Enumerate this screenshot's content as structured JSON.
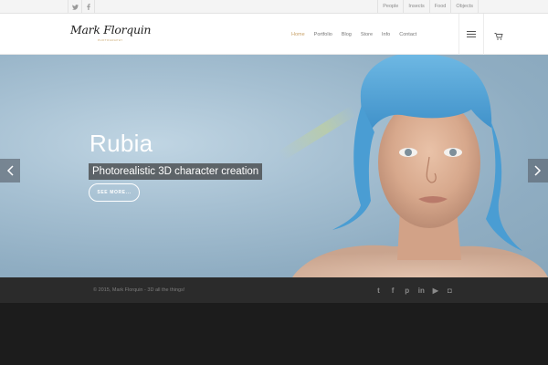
{
  "topbar": {
    "social_icons": [
      "twitter-icon",
      "facebook-icon"
    ],
    "links": [
      "People",
      "Insects",
      "Food",
      "Objects"
    ]
  },
  "header": {
    "logo_signature": "Mark Florquin",
    "logo_tagline": "PHOTOGRAPHY",
    "nav": [
      "Home",
      "Portfolio",
      "Blog",
      "Store",
      "Info",
      "Contact"
    ],
    "active_nav": "Home",
    "accent_color": "#c9a36a"
  },
  "hero": {
    "title": "Rubia",
    "subtitle": "Photorealistic 3D character creation",
    "button": "SEE MORE..."
  },
  "footer": {
    "copyright": "© 2015, Mark Florquin - 3D all the things!",
    "social": [
      {
        "icon": "twitter-icon",
        "glyph": "t"
      },
      {
        "icon": "facebook-icon",
        "glyph": "f"
      },
      {
        "icon": "pinterest-icon",
        "glyph": "p"
      },
      {
        "icon": "linkedin-icon",
        "glyph": "in"
      },
      {
        "icon": "youtube-icon",
        "glyph": "▶"
      },
      {
        "icon": "instagram-icon",
        "glyph": "◘"
      }
    ]
  }
}
